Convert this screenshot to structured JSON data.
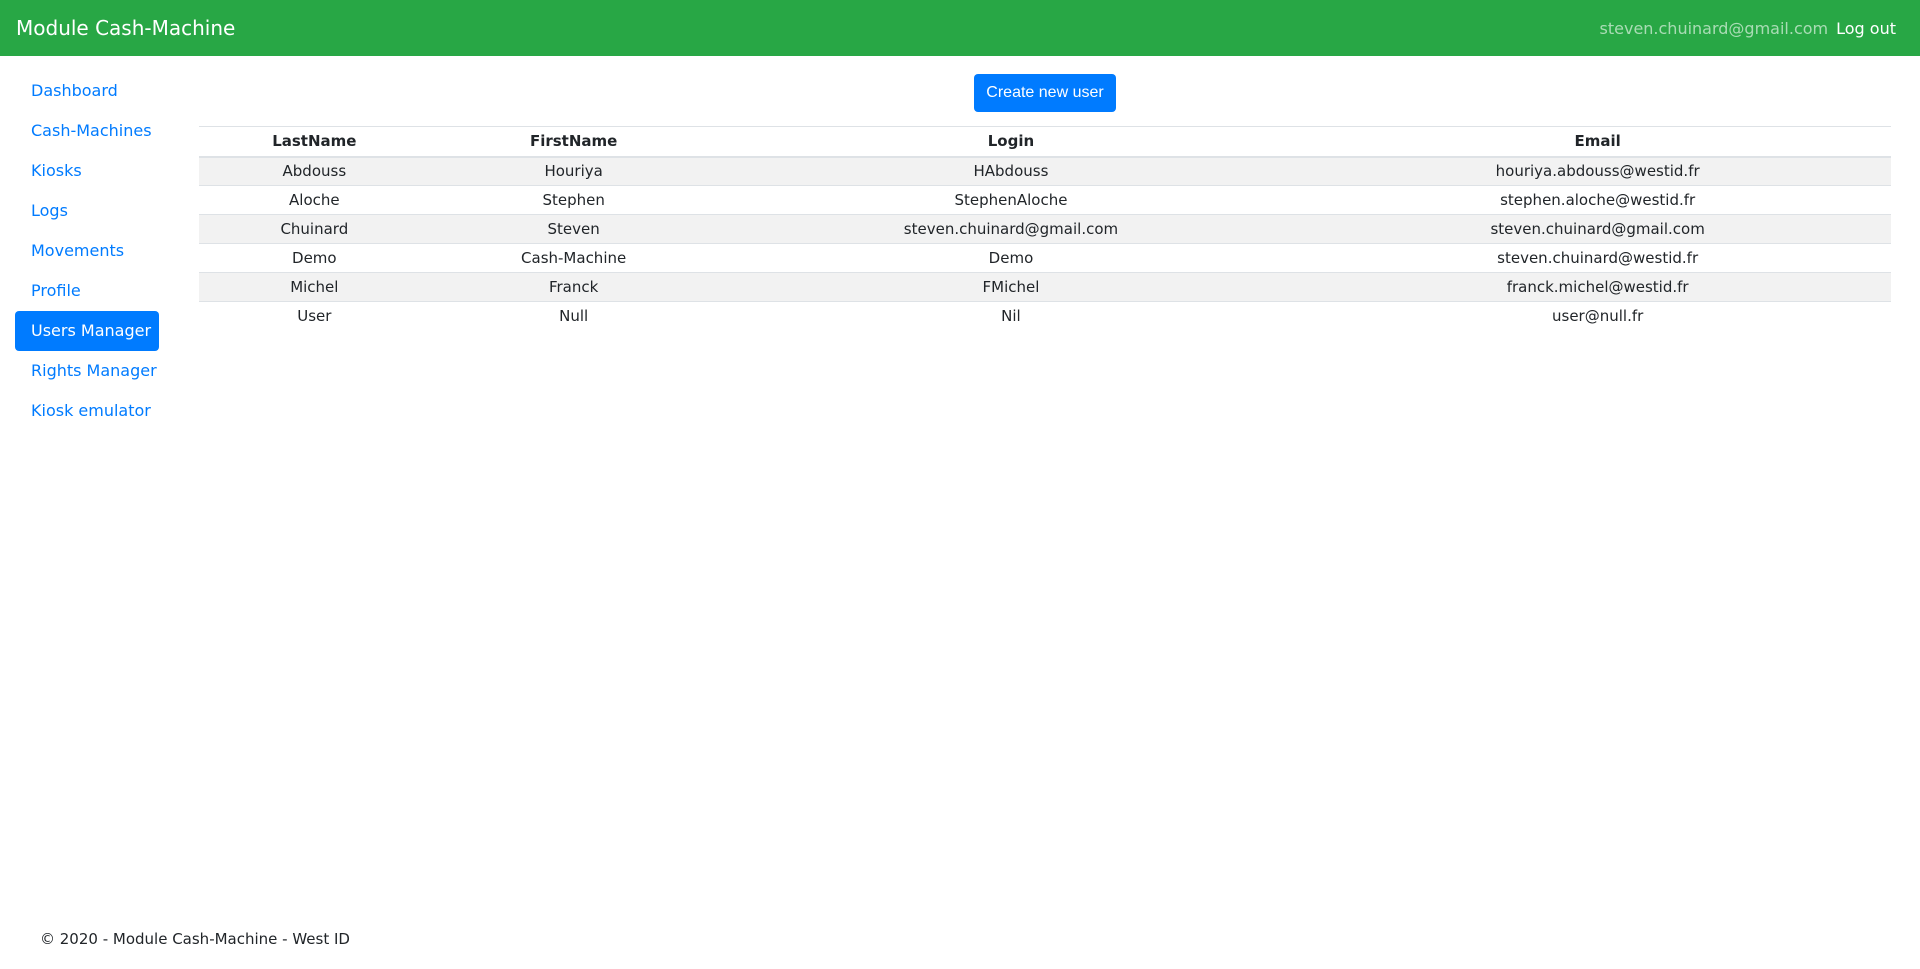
{
  "header": {
    "brand": "Module Cash-Machine",
    "user_email": "steven.chuinard@gmail.com",
    "logout_label": "Log out",
    "bg_color": "#28a745"
  },
  "sidebar": {
    "items": [
      {
        "label": "Dashboard"
      },
      {
        "label": "Cash-Machines"
      },
      {
        "label": "Kiosks"
      },
      {
        "label": "Logs"
      },
      {
        "label": "Movements"
      },
      {
        "label": "Profile"
      },
      {
        "label": "Users Manager",
        "active": true
      },
      {
        "label": "Rights Manager"
      },
      {
        "label": "Kiosk emulator"
      }
    ],
    "accent_color": "#007bff"
  },
  "main": {
    "create_button_label": "Create new user",
    "table": {
      "columns": [
        "LastName",
        "FirstName",
        "Login",
        "Email"
      ],
      "rows": [
        [
          "Abdouss",
          "Houriya",
          "HAbdouss",
          "houriya.abdouss@westid.fr"
        ],
        [
          "Aloche",
          "Stephen",
          "StephenAloche",
          "stephen.aloche@westid.fr"
        ],
        [
          "Chuinard",
          "Steven",
          "steven.chuinard@gmail.com",
          "steven.chuinard@gmail.com"
        ],
        [
          "Demo",
          "Cash-Machine",
          "Demo",
          "steven.chuinard@westid.fr"
        ],
        [
          "Michel",
          "Franck",
          "FMichel",
          "franck.michel@westid.fr"
        ],
        [
          "User",
          "Null",
          "Nil",
          "user@null.fr"
        ]
      ]
    }
  },
  "footer": {
    "text": "© 2020 - Module Cash-Machine - West ID"
  }
}
